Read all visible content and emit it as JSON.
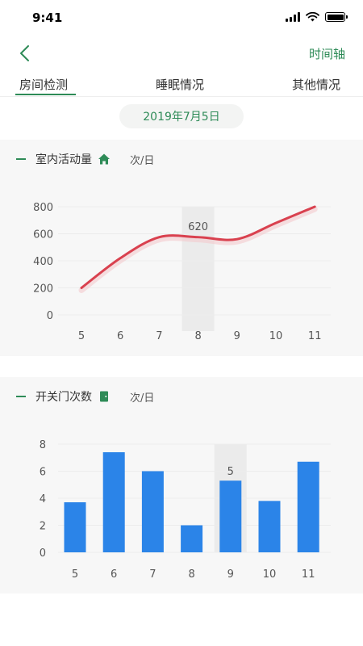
{
  "status_bar": {
    "time": "9:41",
    "battery_level": 1.0
  },
  "nav": {
    "timeline_label": "时间轴"
  },
  "tabs": [
    {
      "label": "房间检测",
      "active": true
    },
    {
      "label": "睡眠情况",
      "active": false
    },
    {
      "label": "其他情况",
      "active": false
    }
  ],
  "date_label": "2019年7月5日",
  "colors": {
    "accent": "#2e8b57",
    "line": "#d9414f",
    "bar": "#2b84e8"
  },
  "activity": {
    "title": "室内活动量",
    "icon": "home-icon",
    "unit": "次/日",
    "chart_data": {
      "type": "line",
      "x": [
        "5",
        "6",
        "7",
        "8",
        "9",
        "10",
        "11"
      ],
      "values": [
        200,
        420,
        575,
        575,
        560,
        680,
        800
      ],
      "ylim": [
        0,
        800
      ],
      "yticks": [
        "0",
        "200",
        "400",
        "600",
        "800"
      ],
      "highlight_index": 3,
      "highlight_label": "620"
    }
  },
  "door": {
    "title": "开关门次数",
    "icon": "door-icon",
    "unit": "次/日",
    "chart_data": {
      "type": "bar",
      "categories": [
        "5",
        "6",
        "7",
        "8",
        "9",
        "10",
        "11"
      ],
      "values": [
        3.7,
        7.4,
        6,
        2,
        5.3,
        3.8,
        6.7
      ],
      "ylim": [
        0,
        8
      ],
      "yticks": [
        "0",
        "2",
        "4",
        "6",
        "8"
      ],
      "highlight_index": 4,
      "highlight_label": "5"
    }
  }
}
